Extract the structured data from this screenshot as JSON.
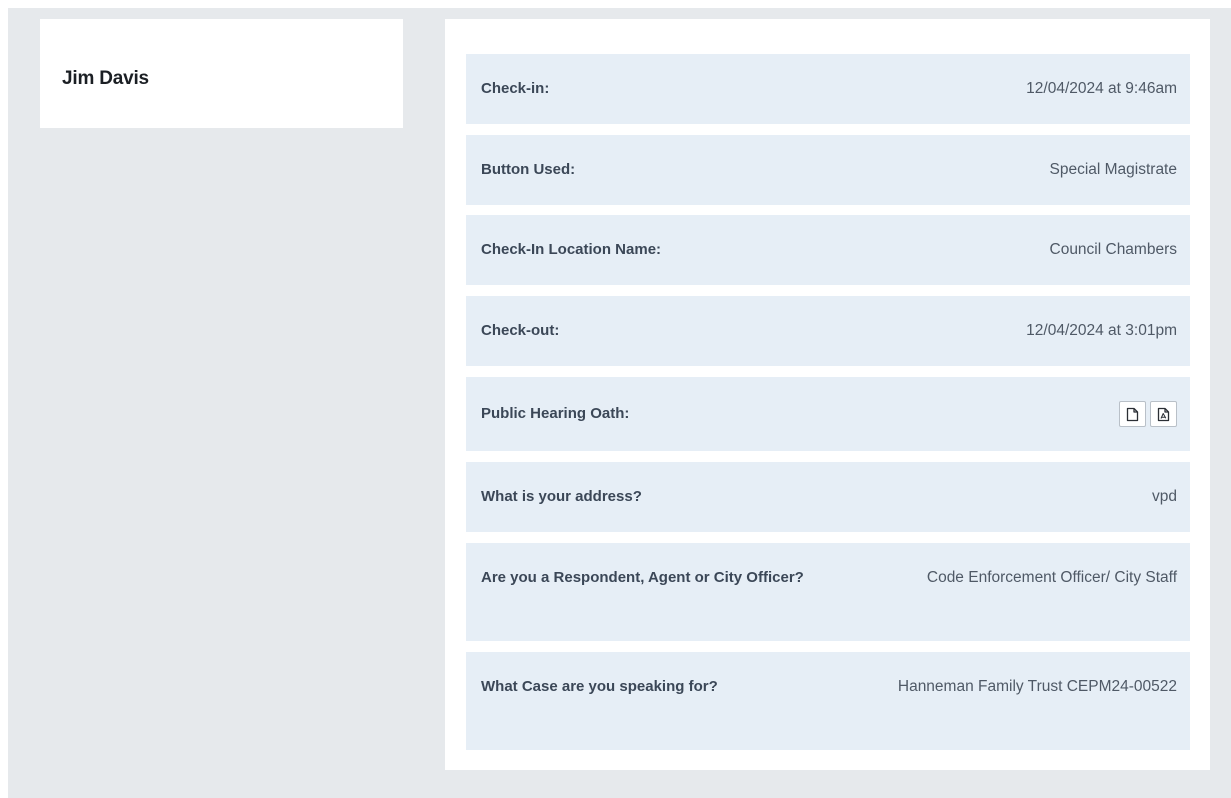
{
  "person": {
    "name": "Jim Davis"
  },
  "details": [
    {
      "label": "Check-in:",
      "value": "12/04/2024 at 9:46am"
    },
    {
      "label": "Button Used:",
      "value": "Special Magistrate"
    },
    {
      "label": "Check-In Location Name:",
      "value": "Council Chambers"
    },
    {
      "label": "Check-out:",
      "value": "12/04/2024 at 3:01pm"
    },
    {
      "label": "Public Hearing Oath:",
      "icons": [
        "document-icon",
        "pdf-icon"
      ]
    },
    {
      "label": "What is your address?",
      "value": "vpd"
    },
    {
      "label": "Are you a Respondent, Agent or City Officer?",
      "value": "Code Enforcement Officer/ City Staff"
    },
    {
      "label": "What Case are you speaking for?",
      "value": "Hanneman Family Trust CEPM24-00522"
    }
  ],
  "colors": {
    "page_background": "#e6e9ec",
    "card_background": "#ffffff",
    "row_background": "#e6eef6",
    "label_text": "#3b4757",
    "value_text": "#4f5966"
  }
}
